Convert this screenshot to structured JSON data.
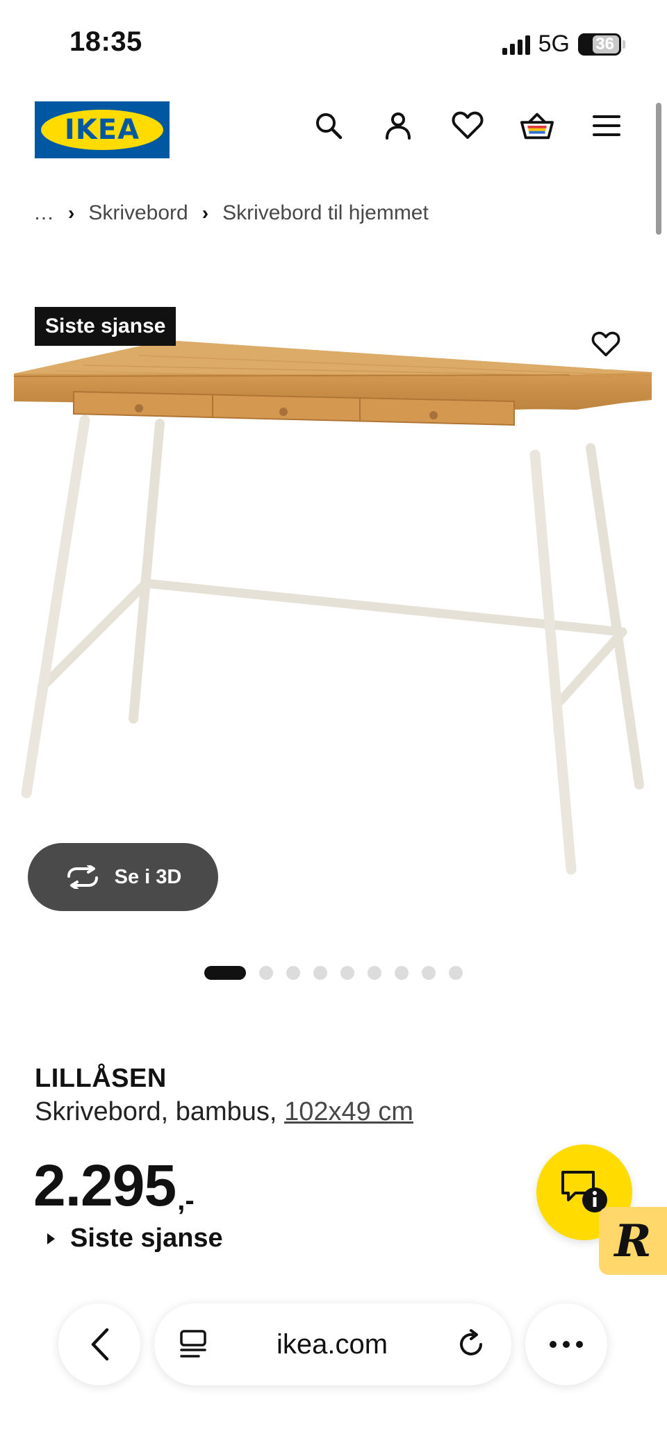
{
  "status_bar": {
    "time": "18:35",
    "network": "5G",
    "battery": "36"
  },
  "header": {
    "logo_text": "IKEA",
    "brand_colors": {
      "blue": "#0058a3",
      "yellow": "#ffdb00"
    },
    "icons": [
      "search-icon",
      "account-icon",
      "heart-icon",
      "basket-icon",
      "menu-icon"
    ]
  },
  "breadcrumb": {
    "items": [
      "…",
      "Skrivebord",
      "Skrivebord til hjemmet"
    ]
  },
  "media": {
    "badge": "Siste sjanse",
    "view_3d_label": "Se i 3D",
    "image_count": 9,
    "active_image": 1
  },
  "product": {
    "name": "LILLÅSEN",
    "description": "Skrivebord, bambus, ",
    "dimensions": "102x49 cm",
    "price": "2.295",
    "price_suffix": ",-",
    "price_note": "Siste sjanse"
  },
  "browser": {
    "url": "ikea.com"
  }
}
